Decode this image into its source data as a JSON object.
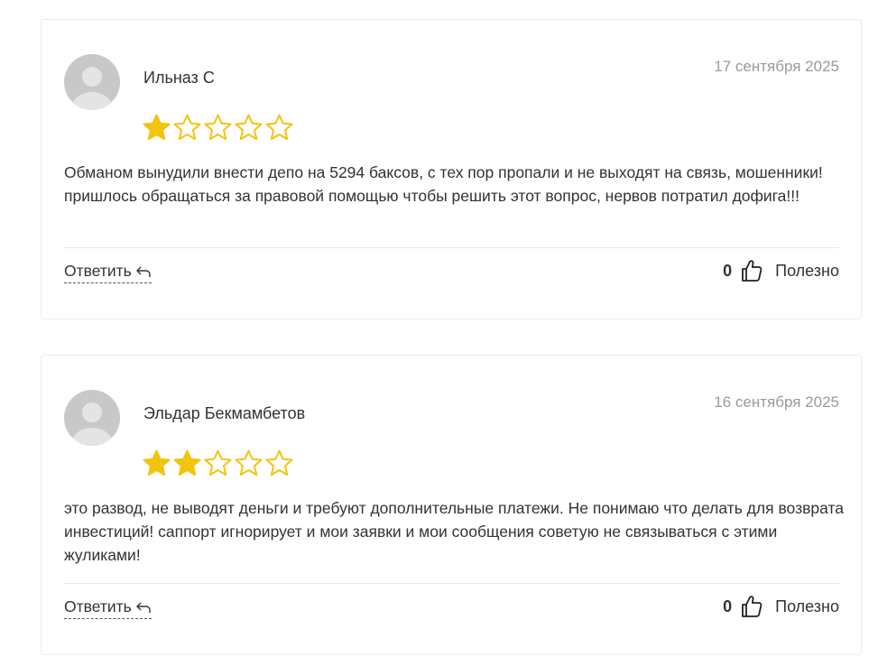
{
  "reviews": [
    {
      "author": "Ильназ С",
      "date": "17 сентября 2025",
      "rating": 1,
      "rating_max": 5,
      "text": "Обманом вынудили внести депо на 5294 баксов, с тех пор пропали и не выходят на связь, мошенники! пришлось обращаться за правовой помощью чтобы решить этот вопрос, нервов потратил дофига!!!",
      "reply_label": "Ответить",
      "helpful_count": "0",
      "helpful_label": "Полезно"
    },
    {
      "author": "Эльдар Бекмамбетов",
      "date": "16 сентября 2025",
      "rating": 2,
      "rating_max": 5,
      "text": "это развод, не выводят деньги и требуют дополнительные платежи. Не понимаю что делать для возврата инвестиций! саппорт игнорирует и мои заявки и мои сообщения советую не связываться с этими жуликами!",
      "reply_label": "Ответить",
      "helpful_count": "0",
      "helpful_label": "Полезно"
    }
  ],
  "colors": {
    "star": "#f1c40f",
    "border": "#ececec",
    "date": "#9a9a9a"
  },
  "icons": {
    "avatar": "user-avatar-placeholder",
    "star": "star-icon",
    "reply": "reply-arrow-icon",
    "thumb": "thumbs-up-icon"
  }
}
